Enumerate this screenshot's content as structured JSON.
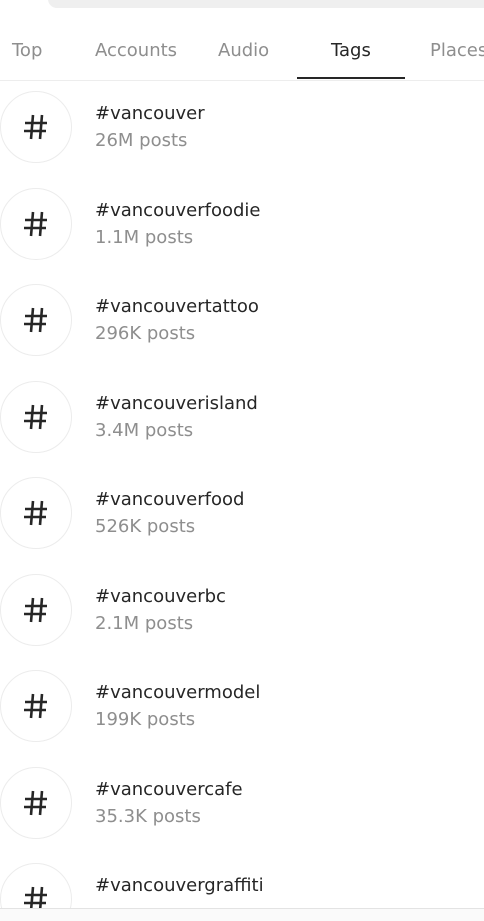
{
  "tabs": [
    {
      "label": "Top",
      "active": false
    },
    {
      "label": "Accounts",
      "active": false
    },
    {
      "label": "Audio",
      "active": false
    },
    {
      "label": "Tags",
      "active": true
    },
    {
      "label": "Places",
      "active": false
    }
  ],
  "icon": "hashtag-icon",
  "results": [
    {
      "tag": "#vancouver",
      "count": "26M posts"
    },
    {
      "tag": "#vancouverfoodie",
      "count": "1.1M posts"
    },
    {
      "tag": "#vancouvertattoo",
      "count": "296K posts"
    },
    {
      "tag": "#vancouverisland",
      "count": "3.4M posts"
    },
    {
      "tag": "#vancouverfood",
      "count": "526K posts"
    },
    {
      "tag": "#vancouverbc",
      "count": "2.1M posts"
    },
    {
      "tag": "#vancouvermodel",
      "count": "199K posts"
    },
    {
      "tag": "#vancouvercafe",
      "count": "35.3K posts"
    },
    {
      "tag": "#vancouvergraffiti",
      "count": ""
    }
  ]
}
